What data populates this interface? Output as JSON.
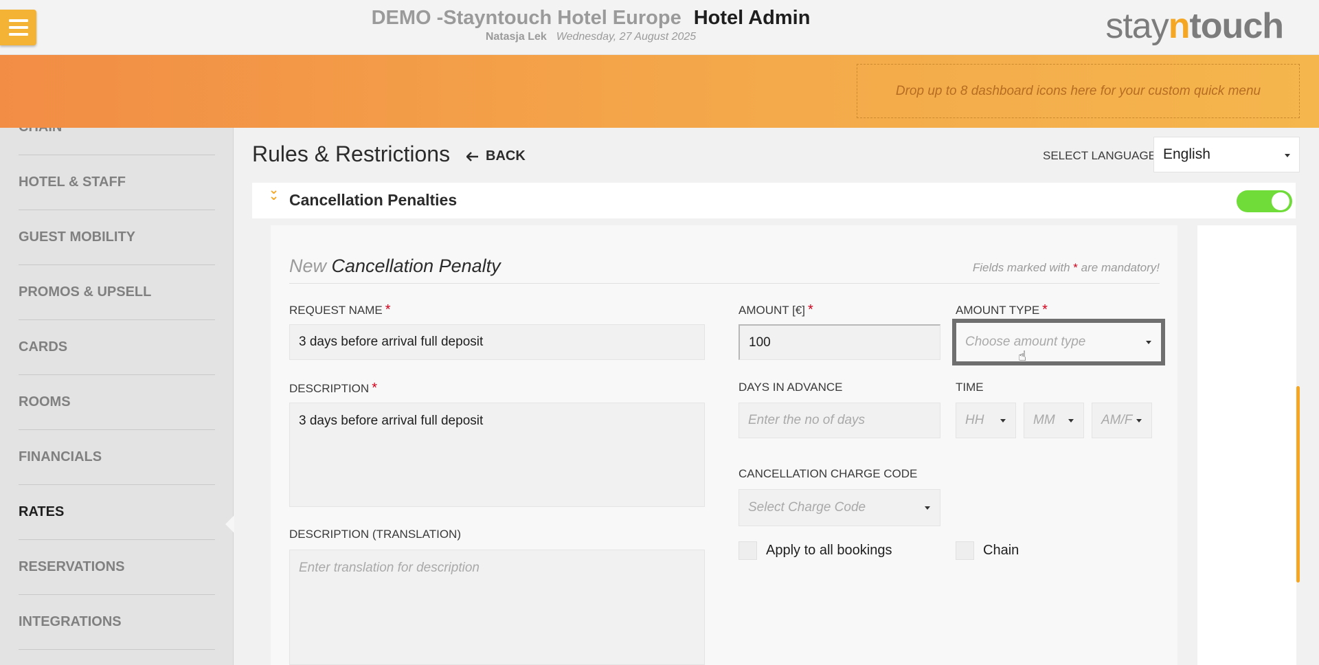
{
  "header": {
    "hotel_name": "DEMO -Stayntouch Hotel Europe",
    "app_name": "Hotel Admin",
    "user": "Natasja Lek",
    "date": "Wednesday, 27 August 2025",
    "menu_icon": "hamburger-menu-icon"
  },
  "logo": {
    "part1": "stay",
    "part2": "n",
    "part3": "touch"
  },
  "banner": {
    "dropzone_text": "Drop up to 8 dashboard icons here for your custom quick menu"
  },
  "sidebar": {
    "items": [
      {
        "label": "CHAIN"
      },
      {
        "label": "HOTEL & STAFF"
      },
      {
        "label": "GUEST MOBILITY"
      },
      {
        "label": "PROMOS & UPSELL"
      },
      {
        "label": "CARDS"
      },
      {
        "label": "ROOMS"
      },
      {
        "label": "FINANCIALS"
      },
      {
        "label": "RATES",
        "active": true
      },
      {
        "label": "RESERVATIONS"
      },
      {
        "label": "INTEGRATIONS"
      }
    ]
  },
  "page": {
    "title": "Rules & Restrictions",
    "back_label": "BACK",
    "select_language_label": "SELECT LANGUAGE",
    "language_value": "English"
  },
  "section": {
    "title": "Cancellation Penalties",
    "toggle_on": true,
    "toggle_color": "#6fdc3a"
  },
  "form": {
    "heading_new": "New",
    "heading_rest": "Cancellation Penalty",
    "mandatory_pre": "Fields marked with",
    "mandatory_star": "*",
    "mandatory_post": "are mandatory!",
    "request_name": {
      "label": "REQUEST NAME",
      "value": "3 days before arrival full deposit"
    },
    "description": {
      "label": "DESCRIPTION",
      "value": "3 days before arrival full deposit"
    },
    "description_translation": {
      "label": "DESCRIPTION (TRANSLATION)",
      "placeholder": "Enter translation for description"
    },
    "amount": {
      "label": "AMOUNT [€]",
      "value": "100"
    },
    "amount_type": {
      "label": "AMOUNT TYPE",
      "placeholder": "Choose amount type"
    },
    "days_in_advance": {
      "label": "DAYS IN ADVANCE",
      "placeholder": "Enter the no of days"
    },
    "time": {
      "label": "TIME",
      "hh": "HH",
      "mm": "MM",
      "ampm": "AM/F"
    },
    "charge_code": {
      "label": "CANCELLATION CHARGE CODE",
      "placeholder": "Select Charge Code"
    },
    "apply_all_label": "Apply to all bookings",
    "chain_label": "Chain",
    "required_marker": "*"
  },
  "colors": {
    "accent": "#f5a623",
    "banner_start": "#f28d45",
    "banner_end": "#f5b64d",
    "required": "#d0021b"
  }
}
